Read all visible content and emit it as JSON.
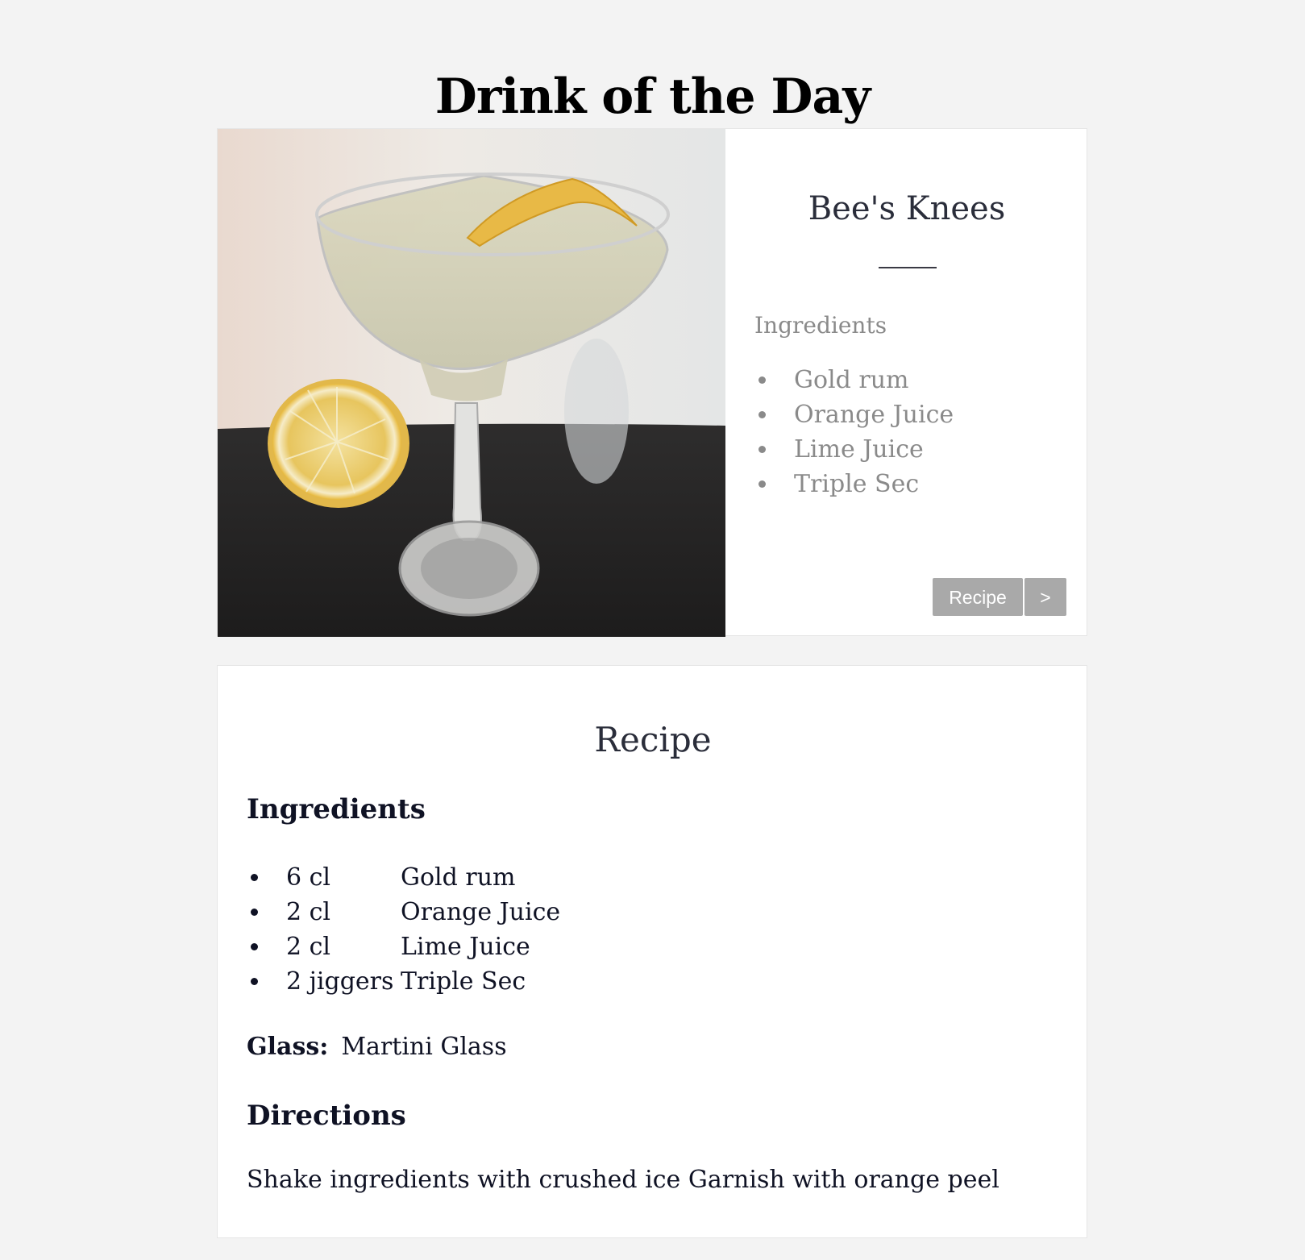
{
  "page": {
    "title": "Drink of the Day"
  },
  "drink_card": {
    "name": "Bee's Knees",
    "ingredients_heading": "Ingredients",
    "ingredients": [
      "Gold rum",
      "Orange Juice",
      "Lime Juice",
      "Triple Sec"
    ],
    "recipe_button_label": "Recipe",
    "next_button_label": ">"
  },
  "recipe": {
    "title": "Recipe",
    "ingredients_heading": "Ingredients",
    "ingredients": [
      {
        "qty": "6 cl",
        "name": "Gold rum"
      },
      {
        "qty": "2 cl",
        "name": "Orange Juice"
      },
      {
        "qty": "2 cl",
        "name": "Lime Juice"
      },
      {
        "qty": "2 jiggers",
        "name": "Triple Sec"
      }
    ],
    "glass_label": "Glass:",
    "glass_value": "Martini Glass",
    "directions_heading": "Directions",
    "directions": "Shake ingredients with crushed ice Garnish with orange peel"
  },
  "colors": {
    "background": "#f3f3f3",
    "card": "#ffffff",
    "muted_text": "#8a8a8a",
    "dark_text": "#0f1224",
    "button": "#a9a9a9"
  }
}
